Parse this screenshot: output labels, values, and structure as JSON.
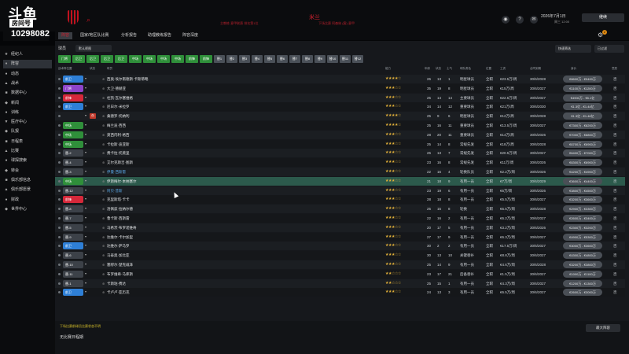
{
  "stream": {
    "brand": "斗鱼",
    "room_label": "房间号",
    "room_number": "10298082"
  },
  "header": {
    "club_title": "米兰",
    "sub_left": "主教练 意甲联赛 排名第1位",
    "sub_right": "下场比赛 阿森纳 (客) 意甲",
    "date": "2026年7月1日",
    "day": "周三 12:00",
    "continue_label": "继续",
    "help_icon": "?",
    "notification_count": "2"
  },
  "nav": {
    "tabs": [
      "阵容",
      "国家/地区队比赛",
      "分析报告",
      "助理教练报告",
      "阵容深度"
    ]
  },
  "sidebar": {
    "items": [
      {
        "icon": "★",
        "label": "经纪人"
      },
      {
        "icon": "♦",
        "label": "阵容"
      },
      {
        "icon": "●",
        "label": "动态"
      },
      {
        "icon": "▲",
        "label": "战术"
      },
      {
        "icon": "■",
        "label": "数据中心"
      },
      {
        "icon": "◆",
        "label": "新闻"
      },
      {
        "icon": "●",
        "label": "训练"
      },
      {
        "icon": "▼",
        "label": "医疗中心"
      },
      {
        "icon": "◆",
        "label": "队报"
      },
      {
        "icon": "■",
        "label": "日程表"
      },
      {
        "icon": "▲",
        "label": "比赛"
      },
      {
        "icon": "●",
        "label": "球探搜索"
      },
      {
        "icon": "◆",
        "label": "转会"
      },
      {
        "icon": "■",
        "label": "俱乐部信息"
      },
      {
        "icon": "▲",
        "label": "俱乐部愿景"
      },
      {
        "icon": "●",
        "label": "财政"
      },
      {
        "icon": "◆",
        "label": "世界中心"
      }
    ]
  },
  "toolbar": {
    "squad_label": "球员",
    "view_select": "默认视图",
    "quick_select": "快速筛选",
    "selected": "已过滤"
  },
  "chips": [
    {
      "label": "门将",
      "color": "#2f8f3a"
    },
    {
      "label": "后卫",
      "color": "#2f8f3a"
    },
    {
      "label": "后卫",
      "color": "#2f8f3a"
    },
    {
      "label": "后卫",
      "color": "#2f8f3a"
    },
    {
      "label": "后卫",
      "color": "#2f8f3a"
    },
    {
      "label": "中场",
      "color": "#2f8f3a"
    },
    {
      "label": "中场",
      "color": "#2f8f3a"
    },
    {
      "label": "中场",
      "color": "#2f8f3a"
    },
    {
      "label": "中场",
      "color": "#2f8f3a"
    },
    {
      "label": "前锋",
      "color": "#2f8f3a"
    },
    {
      "label": "前锋",
      "color": "#2f8f3a"
    },
    {
      "label": "替1",
      "color": "#4a5058"
    },
    {
      "label": "替2",
      "color": "#4a5058"
    },
    {
      "label": "替3",
      "color": "#4a5058"
    },
    {
      "label": "替4",
      "color": "#4a5058"
    },
    {
      "label": "替5",
      "color": "#4a5058"
    },
    {
      "label": "替6",
      "color": "#4a5058"
    },
    {
      "label": "替7",
      "color": "#4a5058"
    },
    {
      "label": "替8",
      "color": "#4a5058"
    },
    {
      "label": "替9",
      "color": "#4a5058"
    },
    {
      "label": "替10",
      "color": "#4a5058"
    },
    {
      "label": "替11",
      "color": "#4a5058"
    },
    {
      "label": "替12",
      "color": "#4a5058"
    }
  ],
  "table": {
    "headers": {
      "position": "战术阵位置",
      "tag": "状态",
      "name": "球员",
      "stars": "能力",
      "age": "年龄",
      "cond": "状态",
      "cv": "士气",
      "role": "球队角色",
      "ln": "位置",
      "wage": "工资",
      "exp": "合同到期",
      "val": "身价",
      "wish": "意愿"
    },
    "rows": [
      {
        "pos": "前卫",
        "poscolor": "#2e7fd6",
        "tag": "",
        "tagcolor": "",
        "name": "西奥·埃尔南德斯·卡斯蒂略",
        "blue": false,
        "stars": "★★★★☆",
        "age": "26",
        "cond": "13",
        "cv": "1",
        "role": "明星球员",
        "ln": "全职",
        "wage": "€23.5万/周",
        "exp": "30/6/2028",
        "val": "€8600万 - €9400万",
        "wish": "否"
      },
      {
        "pos": "门将",
        "poscolor": "#8e44c9",
        "tag": "",
        "tagcolor": "",
        "name": "大卫·德赫亚",
        "blue": false,
        "stars": "★★★☆☆",
        "age": "35",
        "cond": "19",
        "cv": "8",
        "role": "明星球员",
        "ln": "全职",
        "wage": "€15万/周",
        "exp": "30/6/2027",
        "val": "€1100万 - €1200万",
        "wish": "否"
      },
      {
        "pos": "前锋",
        "poscolor": "#d6283a",
        "tag": "",
        "tagcolor": "",
        "name": "杜凯·瓦尔塞维格",
        "blue": false,
        "stars": "★★★☆☆",
        "age": "25",
        "cond": "14",
        "cv": "14",
        "role": "主要球员",
        "ln": "全职",
        "wage": "€22.5万/周",
        "exp": "30/6/2027",
        "val": "€4900万 - €5.1亿",
        "wish": "否"
      },
      {
        "pos": "前卫",
        "poscolor": "#2e7fd6",
        "tag": "",
        "tagcolor": "",
        "name": "尼日尔·米拉罗",
        "blue": false,
        "stars": "★★★☆☆",
        "age": "34",
        "cond": "14",
        "cv": "12",
        "role": "重要球员",
        "ln": "全职",
        "wage": "€21万/周",
        "exp": "30/6/2030",
        "val": "€1.3亿 - €1.44亿",
        "wish": "否"
      },
      {
        "pos": "",
        "poscolor": "",
        "tag": "伤",
        "tagcolor": "#c0392b",
        "name": "桑德罗·托纳利",
        "blue": false,
        "stars": "★★★★☆",
        "age": "25",
        "cond": "9",
        "cv": "6",
        "role": "明星球员",
        "ln": "全职",
        "wage": "€12万/周",
        "exp": "30/6/2028",
        "val": "€1.3亿 - €1.46亿",
        "wish": "否"
      },
      {
        "pos": "中场",
        "poscolor": "#2f8f3a",
        "tag": "",
        "tagcolor": "",
        "name": "梅兰迪·西西",
        "blue": false,
        "stars": "★★★★☆",
        "age": "25",
        "cond": "16",
        "cv": "11",
        "role": "重要球员",
        "ln": "全职",
        "wage": "€13.5万/周",
        "exp": "30/6/2027",
        "val": "€7300万 - €8200万",
        "wish": "否"
      },
      {
        "pos": "中场",
        "poscolor": "#2f8f3a",
        "tag": "",
        "tagcolor": "",
        "name": "莫西内利·格西",
        "blue": false,
        "stars": "★★★☆☆",
        "age": "28",
        "cond": "20",
        "cv": "11",
        "role": "重要球员",
        "ln": "全职",
        "wage": "€14万/周",
        "exp": "30/6/2026",
        "val": "€7000万 - €8800万",
        "wish": "否"
      },
      {
        "pos": "中场",
        "poscolor": "#2f8f3a",
        "tag": "",
        "tagcolor": "",
        "name": "卡拉斯·迪亚斯",
        "blue": false,
        "stars": "★★★☆☆",
        "age": "25",
        "cond": "14",
        "cv": "8",
        "role": "常规先发",
        "ln": "全职",
        "wage": "€18万/周",
        "exp": "30/6/2028",
        "val": "€6700万 - €6900万",
        "wish": "否"
      },
      {
        "pos": "替-2",
        "poscolor": "#3c4148",
        "tag": "",
        "tagcolor": "",
        "name": "费卡拉·托莫里",
        "blue": false,
        "stars": "★★★☆☆",
        "age": "26",
        "cond": "13",
        "cv": "7",
        "role": "常规先发",
        "ln": "全职",
        "wage": "€20.5万/周",
        "exp": "30/6/2027",
        "val": "€6400万 - €7000万",
        "wish": "否"
      },
      {
        "pos": "替-4",
        "poscolor": "#3c4148",
        "tag": "",
        "tagcolor": "",
        "name": "艾尔克斯吉·图斯",
        "blue": false,
        "stars": "★★★☆☆",
        "age": "23",
        "cond": "16",
        "cv": "8",
        "role": "常规先发",
        "ln": "全职",
        "wage": "€11万/周",
        "exp": "30/6/2026",
        "val": "€6300万 - €6900万",
        "wish": "否"
      },
      {
        "pos": "替-3",
        "poscolor": "#3c4148",
        "tag": "",
        "tagcolor": "",
        "name": "伊曼·西斯雷",
        "blue": true,
        "stars": "★★★☆☆",
        "age": "22",
        "cond": "16",
        "cv": "4",
        "role": "轮换队员",
        "ln": "全职",
        "wage": "€2.2万/周",
        "exp": "30/6/2026",
        "val": "€4200万 - €4900万",
        "wish": "否"
      },
      {
        "pos": "中场",
        "poscolor": "#2f8f3a",
        "tag": "",
        "tagcolor": "",
        "name": "伊斯梅尔·本纳塞尔",
        "blue": false,
        "stars": "★★★☆☆",
        "age": "21",
        "cond": "18",
        "cv": "9",
        "role": "有用一员",
        "ln": "全职",
        "wage": "€7万/周",
        "exp": "30/6/2029",
        "val": "€3600万 - €4400万",
        "wish": "否"
      },
      {
        "pos": "替-12",
        "poscolor": "#3c4148",
        "tag": "",
        "tagcolor": "",
        "name": "阿贝·普斯",
        "blue": true,
        "stars": "★★★☆☆",
        "age": "23",
        "cond": "19",
        "cv": "6",
        "role": "有用一员",
        "ln": "全职",
        "wage": "€6万/周",
        "exp": "30/6/2026",
        "val": "€3800万 - €4500万",
        "wish": "否"
      },
      {
        "pos": "前锋",
        "poscolor": "#d6283a",
        "tag": "",
        "tagcolor": "",
        "name": "克里斯塔·卡卡",
        "blue": false,
        "stars": "★★★☆☆",
        "age": "28",
        "cond": "18",
        "cv": "8",
        "role": "有用一员",
        "ln": "全职",
        "wage": "€5.5万/周",
        "exp": "30/6/2027",
        "val": "€3200万 - €3600万",
        "wish": "否"
      },
      {
        "pos": "替-8",
        "poscolor": "#3c4148",
        "tag": "",
        "tagcolor": "",
        "name": "洛佩兹·拉纳尔德",
        "blue": false,
        "stars": "★★★☆☆",
        "age": "25",
        "cond": "15",
        "cv": "8",
        "role": "轮换",
        "ln": "全职",
        "wage": "€6.5万/周",
        "exp": "30/6/2028",
        "val": "€2900万 - €3300万",
        "wish": "否"
      },
      {
        "pos": "替-7",
        "poscolor": "#3c4148",
        "tag": "",
        "tagcolor": "",
        "name": "鲁卡斯·西斯雷",
        "blue": false,
        "stars": "★★★☆☆",
        "age": "22",
        "cond": "16",
        "cv": "2",
        "role": "有用一员",
        "ln": "全职",
        "wage": "€6.2万/周",
        "exp": "30/6/2027",
        "val": "€2600万 - €3400万",
        "wish": "否"
      },
      {
        "pos": "替-5",
        "poscolor": "#3c4148",
        "tag": "",
        "tagcolor": "",
        "name": "马希茨·布罗诺维奇",
        "blue": false,
        "stars": "★★★☆☆",
        "age": "20",
        "cond": "17",
        "cv": "5",
        "role": "有用一员",
        "ln": "全职",
        "wage": "€3.2万/周",
        "exp": "30/6/2026",
        "val": "€2300万 - €3200万",
        "wish": "否"
      },
      {
        "pos": "替-9",
        "poscolor": "#3c4148",
        "tag": "",
        "tagcolor": "",
        "name": "达维尔·卡尔加里",
        "blue": false,
        "stars": "★★★☆☆",
        "age": "27",
        "cond": "17",
        "cv": "9",
        "role": "有用一员",
        "ln": "全职",
        "wage": "€6.3万/周",
        "exp": "30/6/2027",
        "val": "€4900万 - €5300万",
        "wish": "否"
      },
      {
        "pos": "前卫",
        "poscolor": "#2e7fd6",
        "tag": "",
        "tagcolor": "",
        "name": "达维尔·萨马罗",
        "blue": false,
        "stars": "★★★☆☆",
        "age": "30",
        "cond": "2",
        "cv": "2",
        "role": "有用一员",
        "ln": "全职",
        "wage": "€17.5万/周",
        "exp": "30/6/2027",
        "val": "€3000万 - €3600万",
        "wish": "否"
      },
      {
        "pos": "替-6",
        "poscolor": "#3c4148",
        "tag": "",
        "tagcolor": "",
        "name": "马泰奥·加比亚",
        "blue": false,
        "stars": "★★★☆☆",
        "age": "30",
        "cond": "13",
        "cv": "10",
        "role": "关键替补",
        "ln": "全职",
        "wage": "€8.8万/周",
        "exp": "30/6/2027",
        "val": "€4300万 - €4800万",
        "wish": "否"
      },
      {
        "pos": "替-10",
        "poscolor": "#3c4148",
        "tag": "",
        "tagcolor": "",
        "name": "塞缪尔·楚克威泽",
        "blue": false,
        "stars": "★★★☆☆",
        "age": "25",
        "cond": "14",
        "cv": "9",
        "role": "有用一员",
        "ln": "全职",
        "wage": "€4.6万/周",
        "exp": "30/6/2028",
        "val": "€3200万 - €3800万",
        "wish": "否"
      },
      {
        "pos": "替-11",
        "poscolor": "#3c4148",
        "tag": "",
        "tagcolor": "",
        "name": "布罗维奇·马库斯",
        "blue": false,
        "stars": "★★☆☆☆",
        "age": "23",
        "cond": "17",
        "cv": "21",
        "role": "后备替补",
        "ln": "全职",
        "wage": "€1.5万/周",
        "exp": "30/6/2027",
        "val": "€1000万 - €1100万",
        "wish": "否"
      },
      {
        "pos": "替-1",
        "poscolor": "#3c4148",
        "tag": "",
        "tagcolor": "",
        "name": "卡斯珀·费达",
        "blue": false,
        "stars": "★★☆☆☆",
        "age": "25",
        "cond": "15",
        "cv": "1",
        "role": "有用一员",
        "ln": "全职",
        "wage": "€4.3万/周",
        "exp": "30/6/2027",
        "val": "€1200万 - €1300万",
        "wish": "否"
      },
      {
        "pos": "前卫",
        "poscolor": "#2e7fd6",
        "tag": "",
        "tagcolor": "",
        "name": "卡卢卢·亚历克",
        "blue": false,
        "stars": "★★★☆☆",
        "age": "24",
        "cond": "13",
        "cv": "3",
        "role": "有用一员",
        "ln": "全职",
        "wage": "€6.5万/周",
        "exp": "30/6/2027",
        "val": "€2600万 - €3000万",
        "wish": "否"
      }
    ]
  },
  "bottom": {
    "note": "下场比赛前球员比赛状态不明",
    "label": "无比赛日程期",
    "max_button": "最大阵容"
  }
}
